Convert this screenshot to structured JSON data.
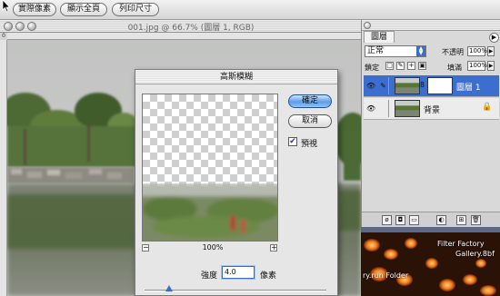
{
  "options_bar": {
    "buttons": [
      "實際像素",
      "顯示全頁",
      "列印尺寸"
    ]
  },
  "document": {
    "title": "001.jpg @ 66.7% (圖層 1, RGB)",
    "ruler_origin": "0"
  },
  "dialog": {
    "title": "高斯模糊",
    "ok_label": "確定",
    "cancel_label": "取消",
    "preview_label": "預視",
    "preview_checked": true,
    "zoom_out": "−",
    "zoom_in": "+",
    "zoom_level": "100%",
    "radius_label": "強度",
    "radius_value": "4.0",
    "radius_unit": "像素"
  },
  "layers_panel": {
    "tab_label": "圖層",
    "menu_arrow": "▶",
    "blend_mode": "正常",
    "opacity_label": "不透明",
    "opacity_value": "100%",
    "lock_label": "鎖定",
    "fill_label": "填滿",
    "fill_value": "100%",
    "layers": [
      {
        "name": "圖層 1",
        "active": true
      },
      {
        "name": "背景",
        "active": false
      }
    ]
  },
  "dock": {
    "line1": "Filter Factory",
    "line2": "Gallery.8bf",
    "line3": "ry.run Folder"
  },
  "colors": {
    "accent": "#3c6ed0",
    "dialog_bg": "#e6e6e6",
    "default_button": "#5d9ee8"
  }
}
